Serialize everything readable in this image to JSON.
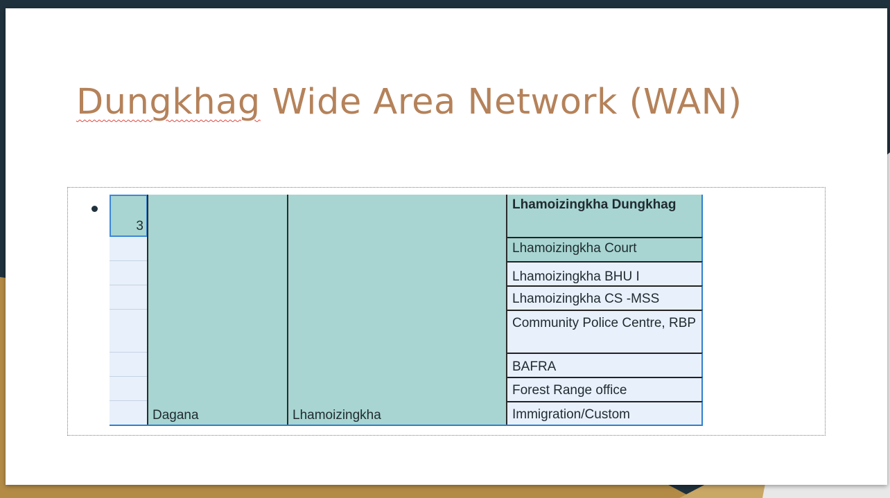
{
  "slide": {
    "title_underlined": "Dungkhag",
    "title_rest": " Wide Area Network (WAN)"
  },
  "table": {
    "row_number": "3",
    "dzongkhag": "Dagana",
    "dungkhag": "Lhamoizingkha",
    "sites": [
      "Lhamoizingkha Dungkhag",
      "Lhamoizingkha Court",
      "Lhamoizingkha BHU I",
      "Lhamoizingkha CS -MSS",
      "Community Police Centre, RBP",
      "BAFRA",
      "Forest Range office",
      "Immigration/Custom"
    ]
  },
  "colors": {
    "title": "#b5825a",
    "teal_cell": "#a8d5d1",
    "light_cell": "#e8f0fb",
    "selection_border": "#3d86d6",
    "background_dark": "#1f313c",
    "background_gold": "#b38b45"
  }
}
